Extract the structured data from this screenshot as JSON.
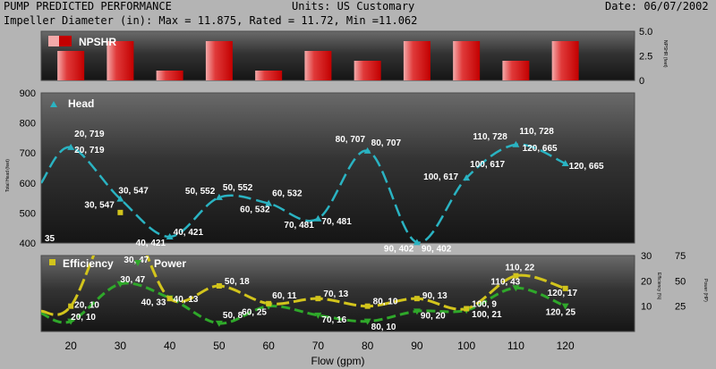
{
  "header": {
    "title": "PUMP PREDICTED PERFORMANCE",
    "units": "Units: US Customary",
    "date": "Date: 06/07/2002",
    "impeller": "Impeller Diameter (in): Max = 11.875, Rated = 11.72, Min =11.062"
  },
  "chart_data": [
    {
      "type": "bar",
      "panel": "npshr",
      "legend": [
        "NPSHR"
      ],
      "ylabel": "NPSHR (feet)",
      "ylim": [
        0,
        5
      ],
      "yticks": [
        "0",
        "2.5",
        "5.0"
      ],
      "categories": [
        20,
        30,
        40,
        50,
        60,
        70,
        80,
        90,
        100,
        110,
        120
      ],
      "values": [
        3,
        4,
        1,
        4,
        1,
        3,
        2,
        4,
        4,
        2,
        4
      ],
      "colors": {
        "bar_light": "#f4aaaa",
        "bar_dark": "#c30000"
      }
    },
    {
      "type": "line",
      "panel": "head",
      "legend": [
        "Head"
      ],
      "ylabel": "Total Head (feet)",
      "ylim": [
        400,
        900
      ],
      "yticks": [
        "400",
        "500",
        "600",
        "700",
        "800",
        "900"
      ],
      "series": [
        {
          "name": "Head",
          "color": "#2ab3c2",
          "x": [
            20,
            30,
            40,
            50,
            60,
            70,
            80,
            90,
            100,
            110,
            120
          ],
          "y": [
            719,
            547,
            421,
            552,
            532,
            481,
            707,
            402,
            617,
            728,
            665
          ]
        }
      ],
      "point_labels": [
        "20, 719",
        "30, 547",
        "40, 421",
        "50, 552",
        "60, 532",
        "70, 481",
        "80, 707",
        "90, 402",
        "100, 617",
        "110, 728",
        "120, 665"
      ],
      "edge_label": "35"
    },
    {
      "type": "line",
      "panel": "efficiency_power",
      "legend": [
        "Efficiency",
        "Power"
      ],
      "xlabel": "Flow (gpm)",
      "xlim": [
        14,
        134
      ],
      "xticks": [
        "20",
        "30",
        "40",
        "50",
        "60",
        "70",
        "80",
        "90",
        "100",
        "110",
        "120"
      ],
      "y1label": "Efficiency (%)",
      "y1ticks": [
        "10",
        "20",
        "30"
      ],
      "y2label": "Power (HP)",
      "y2ticks": [
        "25",
        "50",
        "75"
      ],
      "series": [
        {
          "name": "Efficiency",
          "color": "#d2c41c",
          "x": [
            20,
            30,
            40,
            50,
            60,
            70,
            80,
            90,
            100,
            110,
            120
          ],
          "y": [
            10,
            47,
            13,
            18,
            11,
            13,
            10,
            13,
            9,
            22,
            17
          ],
          "labels": [
            "20, 10",
            "30, 47",
            "40, 13",
            "50, 18",
            "60, 11",
            "70, 13",
            "80, 10",
            "90, 13",
            "100, 9",
            "110, 22",
            "120, 17"
          ]
        },
        {
          "name": "Power",
          "color": "#2fa82a",
          "x": [
            20,
            30,
            40,
            50,
            60,
            70,
            80,
            90,
            100,
            110,
            120
          ],
          "y": [
            10,
            47,
            33,
            8,
            25,
            16,
            10,
            20,
            21,
            43,
            25
          ],
          "labels": [
            "20, 10",
            "30, 47",
            "40, 33",
            "50, 8",
            "60, 25",
            "70, 16",
            "80, 10",
            "90, 20",
            "100, 21",
            "110, 43",
            "120, 25"
          ]
        }
      ]
    }
  ]
}
